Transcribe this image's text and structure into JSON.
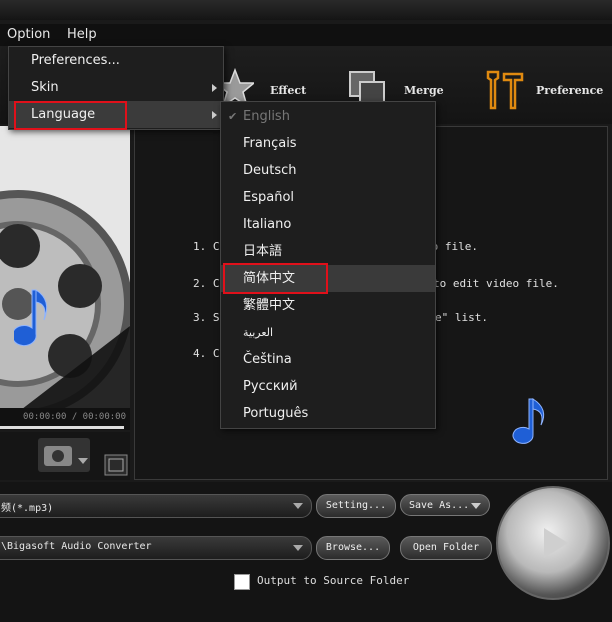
{
  "menubar": {
    "option": "Option",
    "help": "Help"
  },
  "toolbar": {
    "effect": "Effect",
    "merge": "Merge",
    "preference": "Preference"
  },
  "option_menu": {
    "items": [
      {
        "label": "Preferences...",
        "submenu": false
      },
      {
        "label": "Skin",
        "submenu": true
      },
      {
        "label": "Language",
        "submenu": true,
        "highlighted": true
      }
    ]
  },
  "language_menu": {
    "items": [
      {
        "label": "English",
        "checked": true,
        "disabled": true
      },
      {
        "label": "Français"
      },
      {
        "label": "Deutsch"
      },
      {
        "label": "Español"
      },
      {
        "label": "Italiano"
      },
      {
        "label": "日本語"
      },
      {
        "label": "简体中文",
        "highlighted": true
      },
      {
        "label": "繁體中文"
      },
      {
        "label": "العربية"
      },
      {
        "label": "Čeština"
      },
      {
        "label": "Русский"
      },
      {
        "label": "Português"
      }
    ]
  },
  "player": {
    "time": "00:00:00 / 00:00:00"
  },
  "info": {
    "heading_fragment": "l",
    "steps": [
      {
        "num": "1. Cl",
        "tail": "eo file."
      },
      {
        "num": "2. Cl",
        "tail": "to edit video file."
      },
      {
        "num": "3. Se",
        "tail": "e\" list."
      },
      {
        "num": "4. Cl",
        "tail": ""
      }
    ]
  },
  "output": {
    "profile": "频(*.mp3)",
    "destination": "\\Bigasoft Audio Converter",
    "setting_label": "Setting...",
    "save_as_label": "Save As...",
    "browse_label": "Browse...",
    "open_folder_label": "Open Folder",
    "output_to_source_label": "Output to Source Folder",
    "output_to_source_checked": false
  },
  "colors": {
    "highlight_box": "#e0101a",
    "accent_orange": "#e08a10",
    "note_blue": "#1f5fd6"
  },
  "icons": [
    "star-icon",
    "merge-icon",
    "tools-icon",
    "camera-icon",
    "fullscreen-icon",
    "music-note-icon",
    "play-icon",
    "checkmark-icon",
    "submenu-arrow-icon"
  ]
}
